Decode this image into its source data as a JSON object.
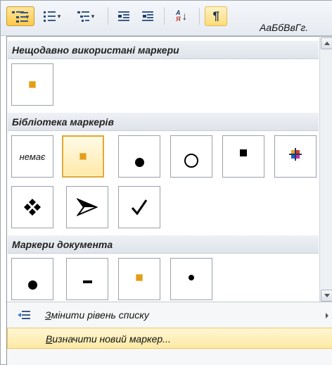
{
  "ribbon": {
    "style_preview": "АаБбВвГг.",
    "pilcrow": "¶",
    "sort_top": "А",
    "sort_bottom": "Я"
  },
  "panel": {
    "recent_header": "Нещодавно використані маркери",
    "library_header": "Бібліотека маркерів",
    "library_none_label": "немає",
    "document_header": "Маркери документа"
  },
  "menu": {
    "change_level_prefix": "З",
    "change_level_rest": "мінити рівень списку",
    "define_new_prefix": "В",
    "define_new_rest": "изначити новий маркер..."
  },
  "icons": {
    "recent": [
      "orange-square"
    ],
    "library": [
      "none",
      "orange-square",
      "black-dot",
      "hollow-circle",
      "black-square",
      "multicolor-cross",
      "diamond-of-four",
      "arrowhead",
      "checkmark"
    ],
    "document": [
      "black-dot",
      "dash",
      "orange-square",
      "small-dot"
    ]
  },
  "colors": {
    "orange_square": "#e39d19",
    "selection_border": "#e1a93a",
    "highlight": "#fde9a4"
  }
}
